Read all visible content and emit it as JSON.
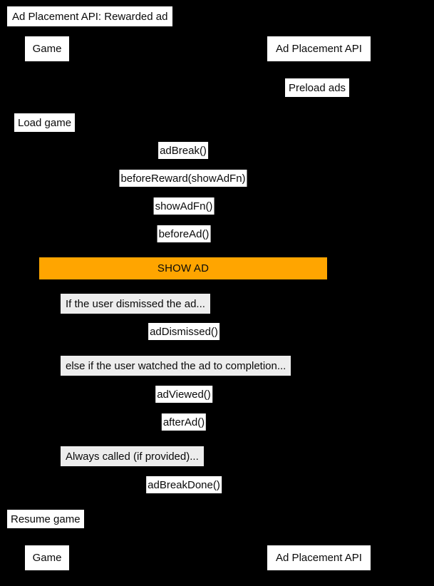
{
  "diagram": {
    "title": "Ad Placement API: Rewarded ad",
    "type": "sequence-diagram",
    "background_color": "#000000",
    "label_color": "#ffffff",
    "condition_color": "#ededed",
    "highlight_color": "#ffa500",
    "text_color": "#0a0a0a"
  },
  "participants": {
    "left": {
      "top_label": "Game",
      "bottom_label": "Game"
    },
    "right": {
      "top_label": "Ad Placement API",
      "bottom_label": "Ad Placement API"
    }
  },
  "notes": {
    "preload": "Preload ads",
    "load_game": "Load game",
    "resume_game": "Resume game"
  },
  "messages": {
    "ad_break": "adBreak()",
    "before_reward": "beforeReward(showAdFn)",
    "show_ad_fn": "showAdFn()",
    "before_ad": "beforeAd()",
    "ad_dismissed": "adDismissed()",
    "ad_viewed": "adViewed()",
    "after_ad": "afterAd()",
    "ad_break_done": "adBreakDone()"
  },
  "fragments": {
    "show_ad": "SHOW AD",
    "if_dismissed": "If the user dismissed the ad...",
    "else_watched": "else if the user watched the ad to completion...",
    "always_called": "Always called (if provided)..."
  }
}
